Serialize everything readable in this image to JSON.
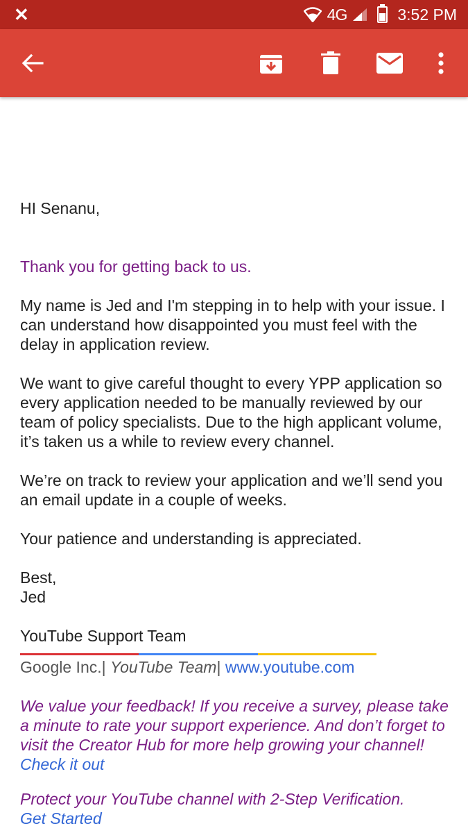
{
  "status_bar": {
    "network": "4G",
    "time": "3:52 PM"
  },
  "toolbar": {
    "icons": [
      "back-arrow-icon",
      "archive-icon",
      "delete-icon",
      "mail-icon",
      "more-vert-icon"
    ],
    "colors": {
      "status_bar": "#b3261e",
      "toolbar": "#db4437"
    }
  },
  "email": {
    "greeting": "HI Senanu,",
    "thanks": "Thank you for getting back to us.",
    "para1": "My name is Jed and I'm stepping in to help with your issue. I can understand how disappointed you must feel with the delay in application review.",
    "para2": "We want to give careful thought to every YPP application so every application needed to be manually reviewed by our team of policy specialists. Due to the high applicant volume, it’s taken us a while to review every channel.",
    "para3": "We’re on track to review your application and we’ll send you an email update in a couple of weeks.",
    "para4": "Your patience and understanding is appreciated.",
    "closing": "Best,",
    "signer": "Jed",
    "team": "YouTube Support Team",
    "signature": {
      "company": "Google Inc.|",
      "team_italic": "YouTube Team",
      "separator": "|",
      "website": "www.youtube.com"
    },
    "feedback_text": "We value your feedback! If you receive a survey, please take a minute to rate your support experience. And don’t forget to visit the Creator Hub for more help growing your channel!",
    "feedback_link": "Check it out",
    "protect_text": "Protect your YouTube channel with 2-Step Verification.",
    "protect_link": "Get Started"
  }
}
